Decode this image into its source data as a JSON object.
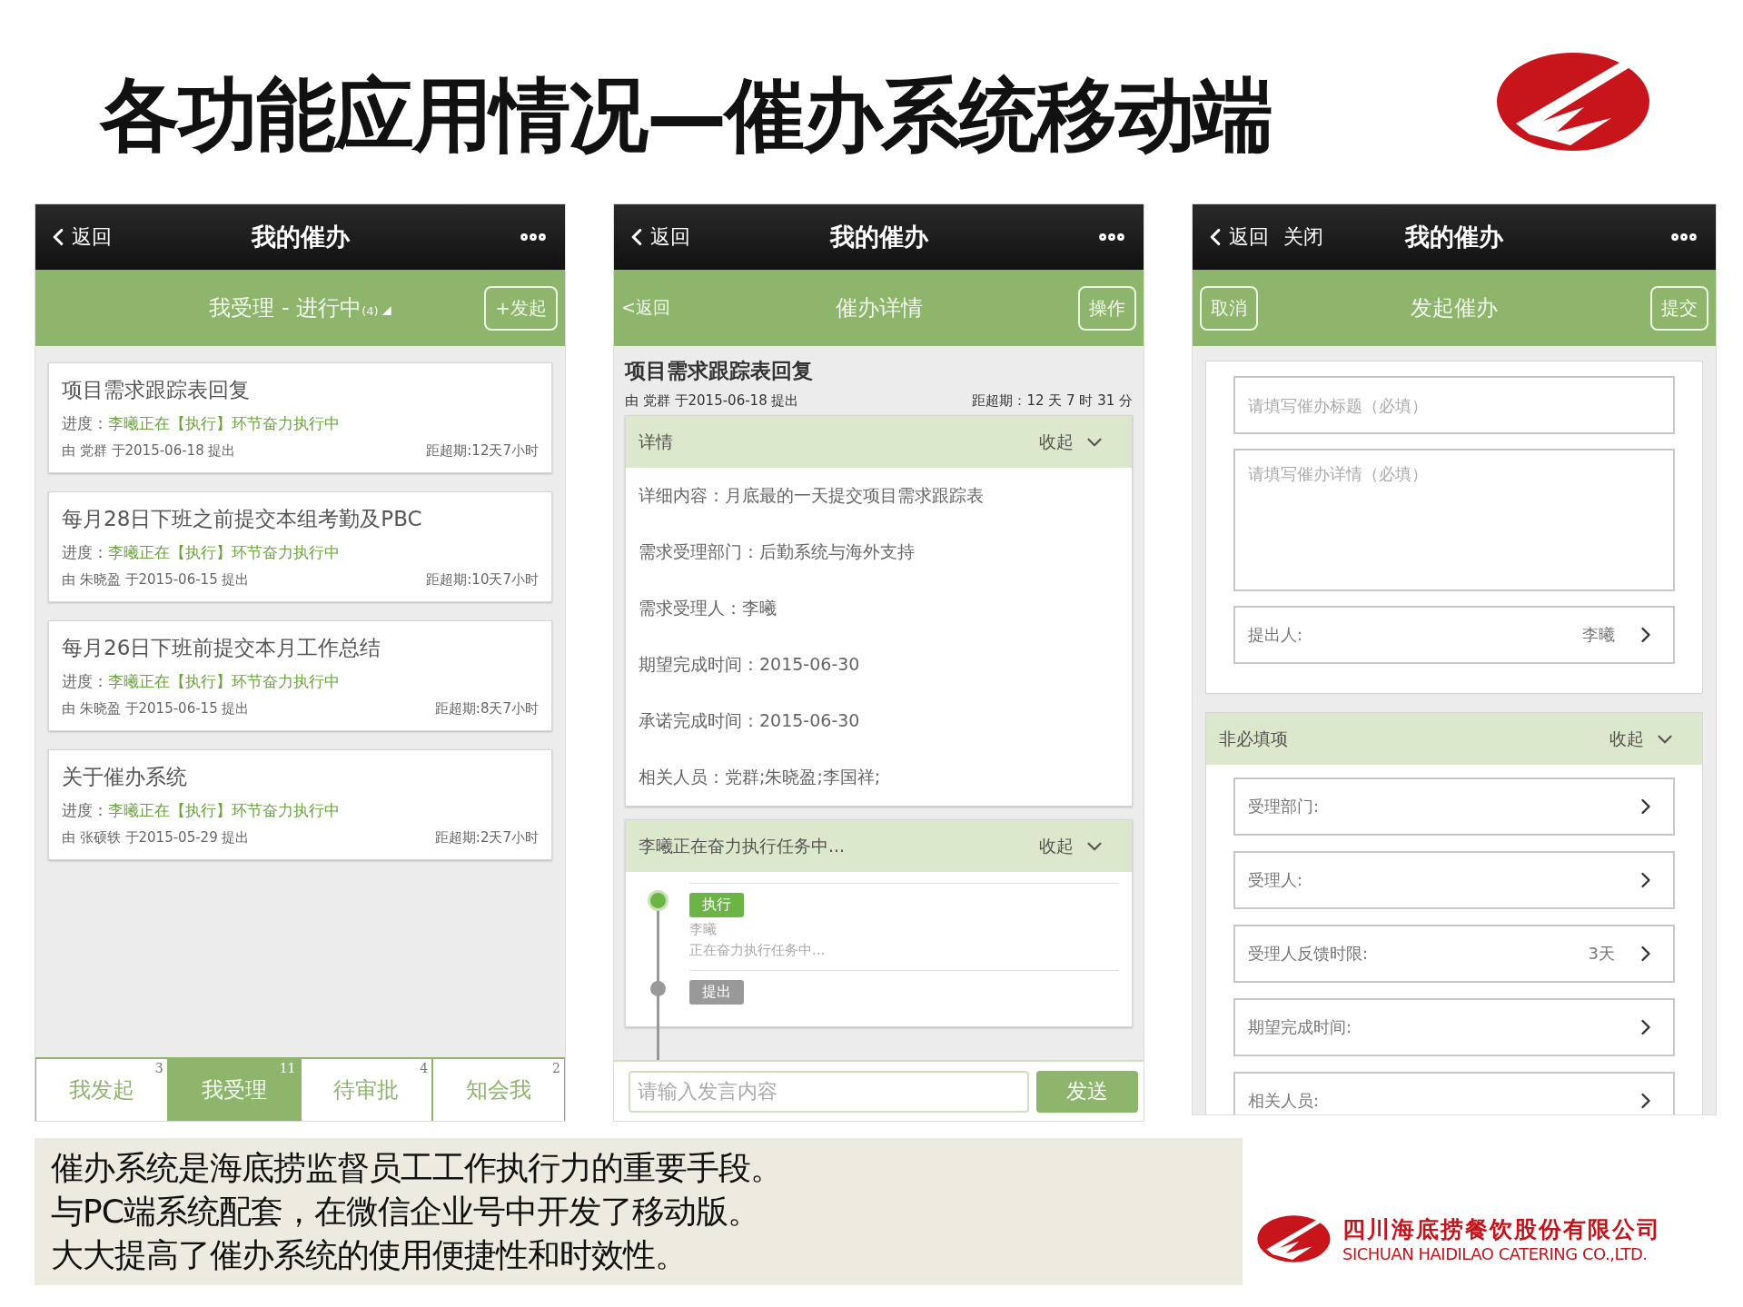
{
  "title": "各功能应用情况—催办系统移动端",
  "list_screen": {
    "nav": {
      "back": "返回",
      "title": "我的催办"
    },
    "header": {
      "title": "我受理 - 进行中",
      "count": "(4)",
      "action": "+发起"
    },
    "cards": [
      {
        "title": "项目需求跟踪表回复",
        "progress_label": "进度：",
        "progress": "李曦正在【执行】环节奋力执行中",
        "submitter": "由 党群 于2015-06-18 提出",
        "deadline": "距超期:12天7小时"
      },
      {
        "title": "每月28日下班之前提交本组考勤及PBC",
        "progress_label": "进度：",
        "progress": "李曦正在【执行】环节奋力执行中",
        "submitter": "由 朱晓盈 于2015-06-15 提出",
        "deadline": "距超期:10天7小时"
      },
      {
        "title": "每月26日下班前提交本月工作总结",
        "progress_label": "进度：",
        "progress": "李曦正在【执行】环节奋力执行中",
        "submitter": "由 朱晓盈 于2015-06-15 提出",
        "deadline": "距超期:8天7小时"
      },
      {
        "title": "关于催办系统",
        "progress_label": "进度：",
        "progress": "李曦正在【执行】环节奋力执行中",
        "submitter": "由 张硕轶 于2015-05-29 提出",
        "deadline": "距超期:2天7小时"
      }
    ],
    "tabs": [
      {
        "label": "我发起",
        "badge": "3",
        "selected": false
      },
      {
        "label": "我受理",
        "badge": "11",
        "selected": true
      },
      {
        "label": "待审批",
        "badge": "4",
        "selected": false
      },
      {
        "label": "知会我",
        "badge": "2",
        "selected": false
      }
    ]
  },
  "detail_screen": {
    "nav": {
      "back": "返回",
      "title": "我的催办"
    },
    "header": {
      "back": "<返回",
      "title": "催办详情",
      "action": "操作"
    },
    "item": {
      "title": "项目需求跟踪表回复",
      "submitter": "由 党群 于2015-06-18 提出",
      "deadline": "距超期：12 天 7 时 31 分"
    },
    "details": {
      "title": "详情",
      "toggle": "收起",
      "rows": [
        {
          "label": "详细内容：",
          "value": "月底最的一天提交项目需求跟踪表"
        },
        {
          "label": "需求受理部门：",
          "value": "后勤系统与海外支持"
        },
        {
          "label": "需求受理人：",
          "value": "李曦"
        },
        {
          "label": "期望完成时间：",
          "value": "2015-06-30"
        },
        {
          "label": "承诺完成时间：",
          "value": "2015-06-30"
        },
        {
          "label": "相关人员：",
          "value": "党群;朱晓盈;李国祥;"
        }
      ]
    },
    "progress": {
      "title": "李曦正在奋力执行任务中...",
      "toggle": "收起",
      "timeline": [
        {
          "tag": "执行",
          "current": true,
          "person": "李曦",
          "note": "正在奋力执行任务中..."
        },
        {
          "tag": "提出",
          "current": false
        }
      ]
    },
    "composer": {
      "placeholder": "请输入发言内容",
      "send": "发送"
    }
  },
  "form_screen": {
    "nav": {
      "back": "返回",
      "close": "关闭",
      "title": "我的催办"
    },
    "header": {
      "cancel": "取消",
      "title": "发起催办",
      "submit": "提交"
    },
    "fields": [
      {
        "kind": "input",
        "placeholder": "请填写催办标题（必填）"
      },
      {
        "kind": "textarea",
        "placeholder": "请填写催办详情（必填）"
      },
      {
        "kind": "select",
        "label": "提出人:",
        "value": "李曦"
      }
    ],
    "optional": {
      "title": "非必填项",
      "toggle": "收起",
      "fields": [
        {
          "label": "受理部门:"
        },
        {
          "label": "受理人:"
        },
        {
          "label": "受理人反馈时限:",
          "value": "3天"
        },
        {
          "label": "期望完成时间:"
        },
        {
          "label": "相关人员:"
        }
      ]
    }
  },
  "caption": [
    "催办系统是海底捞监督员工工作执行力的重要手段。",
    "与PC端系统配套，在微信企业号中开发了移动版。",
    "大大提高了催办系统的使用便捷性和时效性。"
  ],
  "company": {
    "name_cn": "四川海底捞餐饮股份有限公司",
    "name_en": "SICHUAN HAIDILAO CATERING CO.,LTD."
  }
}
